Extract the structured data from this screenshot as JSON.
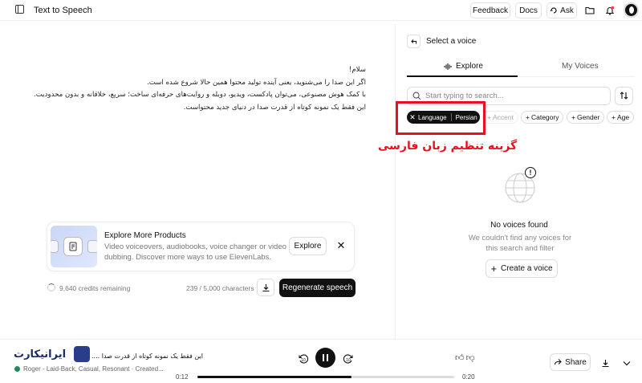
{
  "topbar": {
    "title": "Text to Speech",
    "feedback_label": "Feedback",
    "docs_label": "Docs",
    "ask_label": "Ask"
  },
  "editor": {
    "lines": [
      "سلام!",
      "اگر این صدا را می‌شنوید، یعنی آینده تولید محتوا همین حالا شروع شده است.",
      "با کمک هوش مصنوعی، می‌توان پادکست، ویدیو، دوبله و روایت‌های حرفه‌ای ساخت؛ سریع، خلاقانه و بدون محدودیت.",
      "این فقط یک نمونه کوتاه از قدرت صدا در دنیای جدید محتواست."
    ]
  },
  "explore_card": {
    "title": "Explore More Products",
    "description": "Video voiceovers, audiobooks, voice changer or video dubbing. Discover more ways to use ElevenLabs.",
    "explore_label": "Explore"
  },
  "status": {
    "credits": "9,640 credits remaining",
    "characters": "239 / 5,000 characters",
    "regenerate_label": "Regenerate speech"
  },
  "voice_panel": {
    "title": "Select a voice",
    "tabs": [
      "Explore",
      "My Voices"
    ],
    "search_placeholder": "Start typing to search...",
    "active_filter": {
      "key": "Language",
      "value": "Persian"
    },
    "filters": [
      "Accent",
      "Category",
      "Gender",
      "Age"
    ],
    "empty_title": "No voices found",
    "empty_desc": "We couldn't find any voices for this search and filter",
    "create_label": "Create a voice"
  },
  "annotation": {
    "text": "گزینه تنظیم زبان فارسی",
    "color": "#e8101f"
  },
  "player": {
    "logo_text": "ایرانیکارت",
    "track_title": "این فقط یک نمونه کوتاه از قدرت صدا ....",
    "track_meta": "Roger - Laid-Back, Casual, Resonant · Created...",
    "skip_back_label": "10",
    "skip_fwd_label": "10",
    "time_current": "0:12",
    "time_total": "0:20",
    "progress": 0.6,
    "share_label": "Share"
  },
  "colors": {
    "primary": "#111111",
    "muted": "#888888",
    "border": "#dddddd",
    "accent_green": "#1f8a5b"
  }
}
